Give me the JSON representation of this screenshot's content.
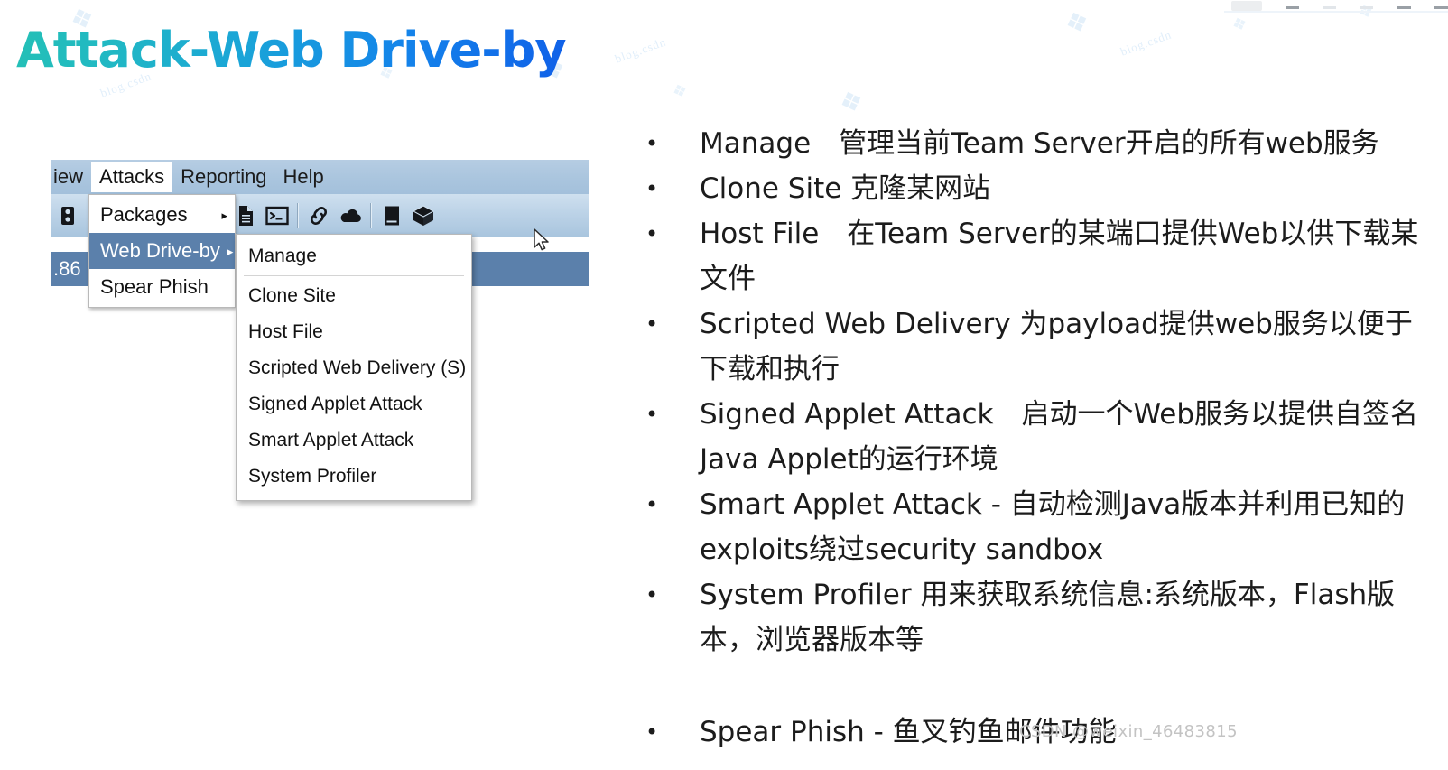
{
  "slide": {
    "title": "Attack-Web Drive-by",
    "watermark": "CSDN @weixin_46483815"
  },
  "app_screenshot": {
    "menubar": [
      {
        "label": "iew",
        "active": false,
        "clipped": true
      },
      {
        "label": "Attacks",
        "active": true,
        "clipped": false
      },
      {
        "label": "Reporting",
        "active": false,
        "clipped": false
      },
      {
        "label": "Help",
        "active": false,
        "clipped": false
      }
    ],
    "toolbar_icons": [
      "hosts-icon",
      "list-icon",
      "separator",
      "image-icon",
      "separator",
      "gear-icon",
      "coffee-cup-icon",
      "document-icon",
      "terminal-icon",
      "separator",
      "link-icon",
      "cloud-icon",
      "separator",
      "book-icon",
      "cube-icon"
    ],
    "table_row": {
      "value": ".86"
    },
    "attacks_menu": [
      {
        "label": "Packages",
        "has_submenu": true,
        "highlighted": false
      },
      {
        "label": "Web Drive-by",
        "has_submenu": true,
        "highlighted": true
      },
      {
        "label": "Spear Phish",
        "has_submenu": false,
        "highlighted": false
      }
    ],
    "web_driveby_submenu": [
      "Manage",
      "Clone Site",
      "Host File",
      "Scripted Web Delivery (S)",
      "Signed Applet Attack",
      "Smart Applet Attack",
      "System Profiler"
    ],
    "submenu_arrow": "▸",
    "colors": {
      "menu_highlight": "#5b80ab",
      "toolbar_top": "#cfe0ef",
      "toolbar_bottom": "#a9c5de",
      "menubar": "#aac5de",
      "selected_row": "#5b80ab"
    }
  },
  "bullets": [
    {
      "text": "Manage　管理当前Team Server开启的所有web服务",
      "gap_before": false
    },
    {
      "text": "Clone Site 克隆某网站",
      "gap_before": false
    },
    {
      "text": "Host File　在Team Server的某端口提供Web以供下载某文件",
      "gap_before": false
    },
    {
      "text": "Scripted Web Delivery 为payload提供web服务以便于下载和执行",
      "gap_before": false
    },
    {
      "text": "Signed Applet Attack　启动一个Web服务以提供自签名Java Applet的运行环境",
      "gap_before": false
    },
    {
      "text": "Smart Applet Attack - 自动检测Java版本并利用已知的exploits绕过security sandbox",
      "gap_before": false
    },
    {
      "text": "System Profiler 用来获取系统信息:系统版本，Flash版本，浏览器版本等",
      "gap_before": false
    },
    {
      "text": "Spear Phish - 鱼叉钓鱼邮件功能",
      "gap_before": true
    }
  ],
  "bullet_marker": "•"
}
